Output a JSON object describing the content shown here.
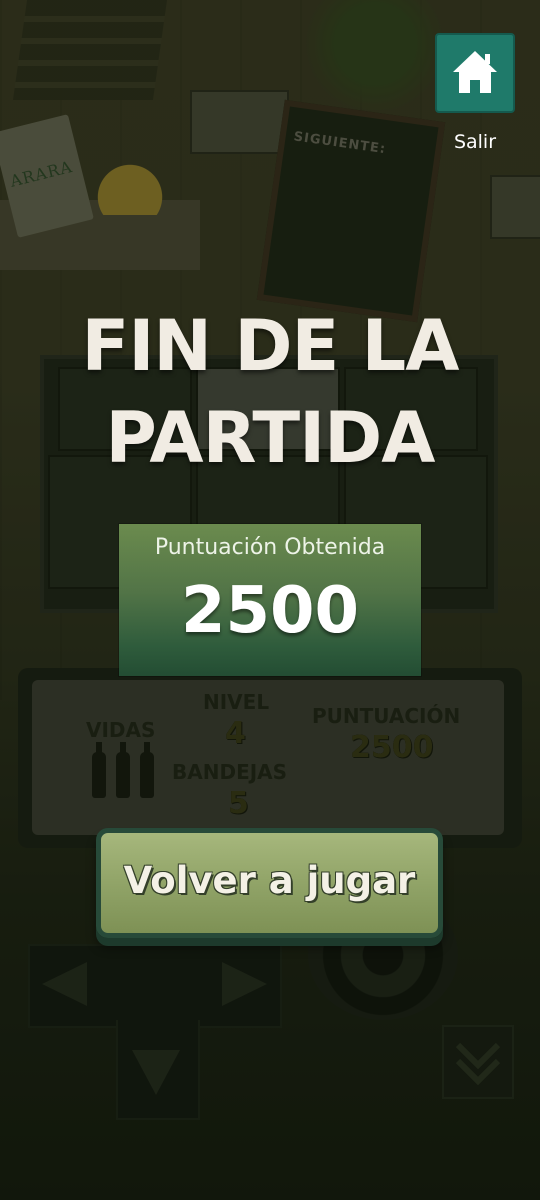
{
  "exit_button": {
    "label": "Salir",
    "icon": "home-icon",
    "color": "#1f7a6a"
  },
  "title": {
    "line1": "FIN DE LA",
    "line2": "PARTIDA"
  },
  "score_card": {
    "label": "Puntuación Obtenida",
    "value": "2500"
  },
  "replay_button": {
    "label": "Volver a jugar"
  },
  "background": {
    "sign_text": "ARARA",
    "board_text": "SIGUIENTE:",
    "hud": {
      "lives_label": "VIDAS",
      "lives_count": 3,
      "level_label": "NIVEL",
      "level_value": "4",
      "trays_label": "BANDEJAS",
      "trays_value": "5",
      "score_label": "PUNTUACIÓN",
      "score_value": "2500"
    }
  }
}
